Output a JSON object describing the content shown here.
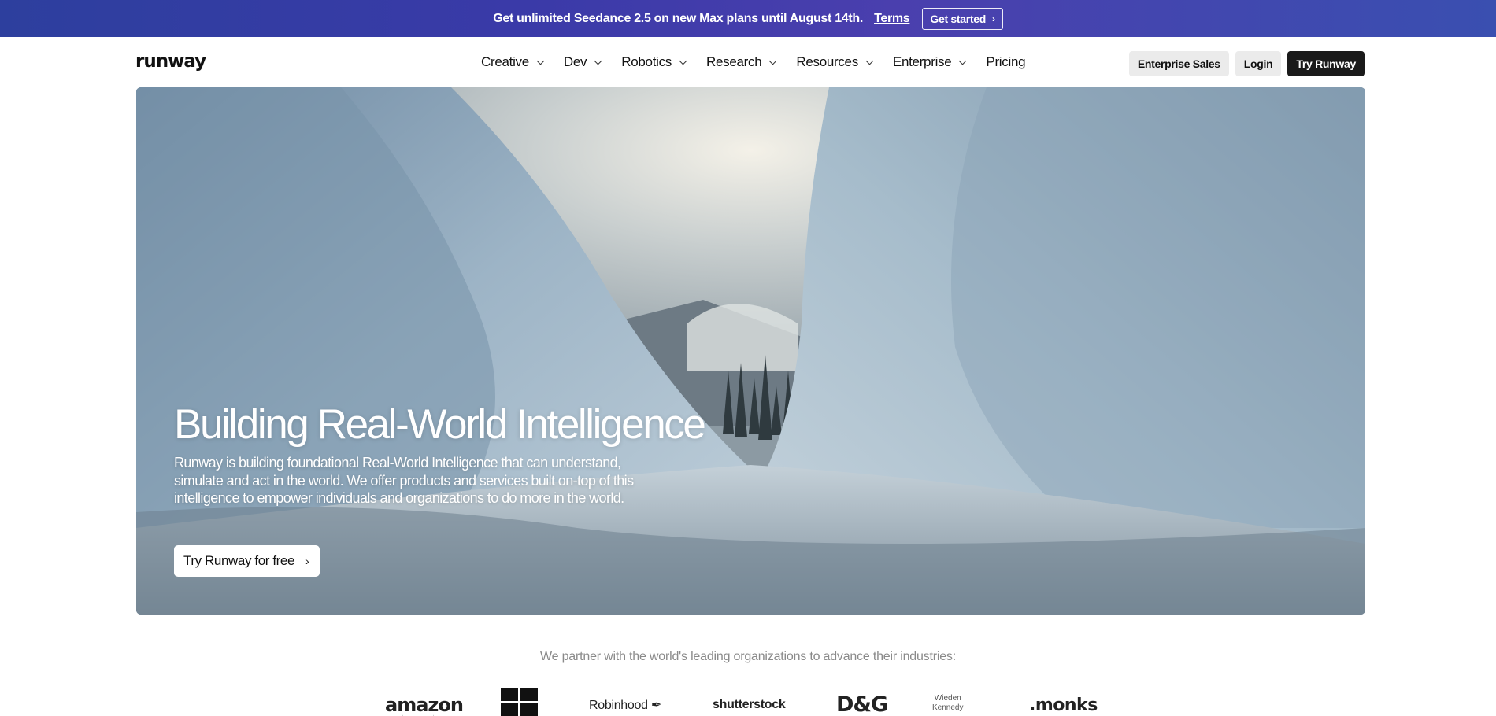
{
  "promo": {
    "message": "Get unlimited Seedance 2.5 on new Max plans until August 14th.",
    "terms_label": "Terms",
    "cta_label": "Get started",
    "cta_icon": "chevron-right-icon"
  },
  "header": {
    "logo": "runway",
    "nav": [
      {
        "label": "Creative",
        "has_dropdown": true
      },
      {
        "label": "Dev",
        "has_dropdown": true
      },
      {
        "label": "Robotics",
        "has_dropdown": true
      },
      {
        "label": "Research",
        "has_dropdown": true
      },
      {
        "label": "Resources",
        "has_dropdown": true
      },
      {
        "label": "Enterprise",
        "has_dropdown": true
      },
      {
        "label": "Pricing",
        "has_dropdown": false
      }
    ],
    "actions": {
      "enterprise_sales": "Enterprise Sales",
      "login": "Login",
      "try_runway": "Try Runway"
    }
  },
  "hero": {
    "title": "Building Real-World Intelligence",
    "description": "Runway is building foundational Real-World Intelligence that can understand, simulate and act in the world. We offer products and services built on-top of this intelligence to empower individuals and organizations to do more in the world.",
    "cta_label": "Try Runway for free",
    "cta_icon": "chevron-right-icon"
  },
  "partners": {
    "heading": "We partner with the world's leading organizations to advance their industries:",
    "logos": {
      "amazon": "amazon",
      "robinhood": "Robinhood",
      "shutterstock": "shutterstock",
      "dg": "D&G",
      "wk_line1": "Wieden",
      "wk_line2": "Kennedy",
      "monks": ".monks"
    }
  },
  "colors": {
    "promo_bg": "#3a3aa8",
    "dark_button": "#1a1a1a",
    "light_button": "#ebebeb",
    "muted_text": "#8a8a8a"
  }
}
